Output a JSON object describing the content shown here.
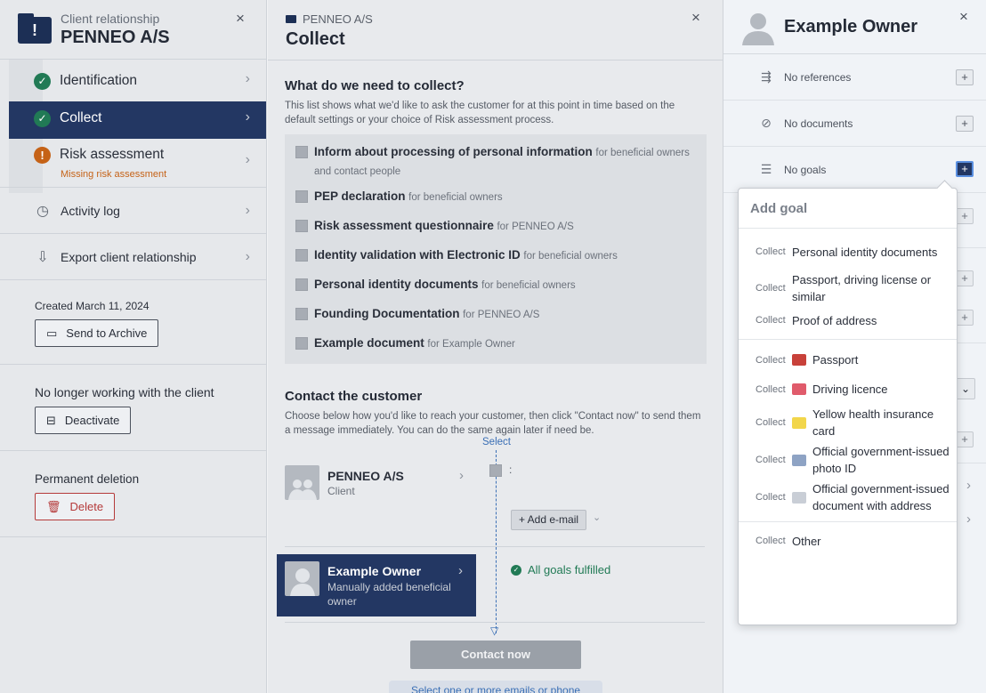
{
  "left": {
    "subtitle": "Client relationship",
    "title": "PENNEO A/S",
    "badge": "!",
    "close": "×",
    "steps": [
      {
        "label": "Identification"
      },
      {
        "label": "Collect"
      },
      {
        "label": "Risk assessment",
        "note": "Missing risk assessment"
      }
    ],
    "links": [
      {
        "label": "Activity log"
      },
      {
        "label": "Export client relationship"
      }
    ],
    "created": "Created March 11, 2024",
    "archive_btn": "Send to Archive",
    "deactivate_label": "No longer working with the client",
    "deactivate_btn": "Deactivate",
    "delete_label": "Permanent deletion",
    "delete_btn": "Delete"
  },
  "mid": {
    "subtitle": "PENNEO A/S",
    "title": "Collect",
    "close": "×",
    "collect_heading": "What do we need to collect?",
    "collect_desc": "This list shows what we'd like to ask the customer for at this point in time based on the default settings or your choice of Risk assessment process.",
    "items": [
      {
        "main": "Inform about processing of personal information",
        "sub": "for beneficial owners and contact people"
      },
      {
        "main": "PEP declaration",
        "sub": "for beneficial owners"
      },
      {
        "main": "Risk assessment questionnaire",
        "sub": "for PENNEO A/S"
      },
      {
        "main": "Identity validation with Electronic ID",
        "sub": "for beneficial owners"
      },
      {
        "main": "Personal identity documents",
        "sub": "for beneficial owners"
      },
      {
        "main": "Founding Documentation",
        "sub": "for PENNEO A/S"
      },
      {
        "main": "Example document",
        "sub": "for Example Owner"
      }
    ],
    "contact_heading": "Contact the customer",
    "contact_desc": "Choose below how you'd like to reach your customer, then click \"Contact now\" to send them a message immediately. You can do the same again later if need be.",
    "select_link": "Select",
    "party1": {
      "name": "PENNEO A/S",
      "role": "Client",
      "colon": ":",
      "add_email": "+ Add e-mail",
      "caret": "⌄"
    },
    "party2": {
      "name": "Example Owner",
      "role": "Manually added beneficial owner",
      "status": "All goals fulfilled"
    },
    "contact_btn": "Contact now",
    "hint": "Select one or more emails or phone"
  },
  "right": {
    "title": "Example Owner",
    "close": "×",
    "rows": [
      {
        "label": "No references",
        "icon": "references-icon"
      },
      {
        "label": "No documents",
        "icon": "paperclip-icon"
      },
      {
        "label": "No goals",
        "icon": "goals-list-icon"
      }
    ],
    "plus": "+"
  },
  "dropdown": {
    "title": "Add goal",
    "verb": "Collect",
    "groups": [
      [
        {
          "text": "Personal identity documents"
        },
        {
          "text": "Passport, driving license or similar"
        },
        {
          "text": "Proof of address"
        }
      ],
      [
        {
          "text": "Passport",
          "icon": "passport-icon",
          "color": "#c8413a"
        },
        {
          "text": "Driving licence",
          "icon": "driving-licence-icon",
          "color": "#e05b6b"
        },
        {
          "text": "Yellow health insurance card",
          "icon": "health-card-icon",
          "color": "#f2d64b"
        },
        {
          "text": "Official government-issued photo ID",
          "icon": "photo-id-icon",
          "color": "#8ea3c4"
        },
        {
          "text": "Official government-issued document with address",
          "icon": "document-icon",
          "color": "#c9ced6"
        }
      ],
      [
        {
          "text": "Other"
        }
      ]
    ]
  }
}
